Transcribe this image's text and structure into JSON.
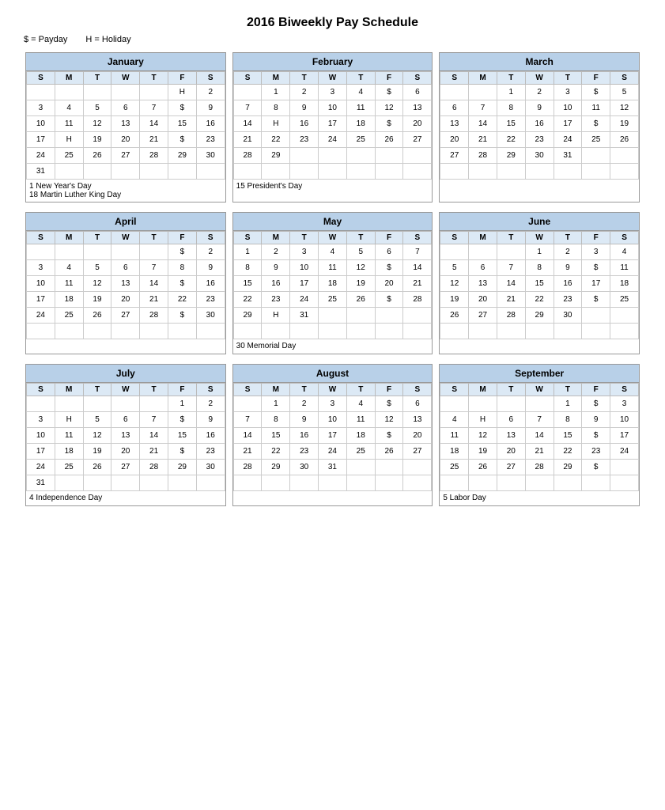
{
  "title": "2016 Biweekly Pay Schedule",
  "legend": {
    "payday": "$ = Payday",
    "holiday": "H = Holiday"
  },
  "months": [
    {
      "name": "January",
      "days_header": [
        "S",
        "M",
        "T",
        "W",
        "T",
        "F",
        "S"
      ],
      "rows": [
        [
          "",
          "",
          "",
          "",
          "",
          "H",
          "2"
        ],
        [
          "3",
          "4",
          "5",
          "6",
          "7",
          "$",
          "9"
        ],
        [
          "10",
          "11",
          "12",
          "13",
          "14",
          "15",
          "16"
        ],
        [
          "17",
          "H",
          "19",
          "20",
          "21",
          "$",
          "23"
        ],
        [
          "24",
          "25",
          "26",
          "27",
          "28",
          "29",
          "30"
        ],
        [
          "31",
          "",
          "",
          "",
          "",
          "",
          ""
        ]
      ],
      "footnotes": [
        "1 New Year's Day",
        "18 Martin Luther King Day"
      ]
    },
    {
      "name": "February",
      "days_header": [
        "S",
        "M",
        "T",
        "W",
        "T",
        "F",
        "S"
      ],
      "rows": [
        [
          "",
          "1",
          "2",
          "3",
          "4",
          "$",
          "6"
        ],
        [
          "7",
          "8",
          "9",
          "10",
          "11",
          "12",
          "13"
        ],
        [
          "14",
          "H",
          "16",
          "17",
          "18",
          "$",
          "20"
        ],
        [
          "21",
          "22",
          "23",
          "24",
          "25",
          "26",
          "27"
        ],
        [
          "28",
          "29",
          "",
          "",
          "",
          "",
          ""
        ],
        [
          "",
          "",
          "",
          "",
          "",
          "",
          ""
        ]
      ],
      "footnotes": [
        "15  President's Day"
      ]
    },
    {
      "name": "March",
      "days_header": [
        "S",
        "M",
        "T",
        "W",
        "T",
        "F",
        "S"
      ],
      "rows": [
        [
          "",
          "",
          "1",
          "2",
          "3",
          "$",
          "5"
        ],
        [
          "6",
          "7",
          "8",
          "9",
          "10",
          "11",
          "12"
        ],
        [
          "13",
          "14",
          "15",
          "16",
          "17",
          "$",
          "19"
        ],
        [
          "20",
          "21",
          "22",
          "23",
          "24",
          "25",
          "26"
        ],
        [
          "27",
          "28",
          "29",
          "30",
          "31",
          "",
          ""
        ],
        [
          "",
          "",
          "",
          "",
          "",
          "",
          ""
        ]
      ],
      "footnotes": []
    },
    {
      "name": "April",
      "days_header": [
        "S",
        "M",
        "T",
        "W",
        "T",
        "F",
        "S"
      ],
      "rows": [
        [
          "",
          "",
          "",
          "",
          "",
          "$",
          "2"
        ],
        [
          "3",
          "4",
          "5",
          "6",
          "7",
          "8",
          "9"
        ],
        [
          "10",
          "11",
          "12",
          "13",
          "14",
          "$",
          "16"
        ],
        [
          "17",
          "18",
          "19",
          "20",
          "21",
          "22",
          "23"
        ],
        [
          "24",
          "25",
          "26",
          "27",
          "28",
          "$",
          "30"
        ],
        [
          "",
          "",
          "",
          "",
          "",
          "",
          ""
        ]
      ],
      "footnotes": []
    },
    {
      "name": "May",
      "days_header": [
        "S",
        "M",
        "T",
        "W",
        "T",
        "F",
        "S"
      ],
      "rows": [
        [
          "1",
          "2",
          "3",
          "4",
          "5",
          "6",
          "7"
        ],
        [
          "8",
          "9",
          "10",
          "11",
          "12",
          "$",
          "14"
        ],
        [
          "15",
          "16",
          "17",
          "18",
          "19",
          "20",
          "21"
        ],
        [
          "22",
          "23",
          "24",
          "25",
          "26",
          "$",
          "28"
        ],
        [
          "29",
          "H",
          "31",
          "",
          "",
          "",
          ""
        ],
        [
          "",
          "",
          "",
          "",
          "",
          "",
          ""
        ]
      ],
      "footnotes": [
        "30  Memorial Day"
      ]
    },
    {
      "name": "June",
      "days_header": [
        "S",
        "M",
        "T",
        "W",
        "T",
        "F",
        "S"
      ],
      "rows": [
        [
          "",
          "",
          "",
          "1",
          "2",
          "3",
          "4"
        ],
        [
          "5",
          "6",
          "7",
          "8",
          "9",
          "$",
          "11"
        ],
        [
          "12",
          "13",
          "14",
          "15",
          "16",
          "17",
          "18"
        ],
        [
          "19",
          "20",
          "21",
          "22",
          "23",
          "$",
          "25"
        ],
        [
          "26",
          "27",
          "28",
          "29",
          "30",
          "",
          ""
        ],
        [
          "",
          "",
          "",
          "",
          "",
          "",
          ""
        ]
      ],
      "footnotes": []
    },
    {
      "name": "July",
      "days_header": [
        "S",
        "M",
        "T",
        "W",
        "T",
        "F",
        "S"
      ],
      "rows": [
        [
          "",
          "",
          "",
          "",
          "",
          "1",
          "2"
        ],
        [
          "3",
          "H",
          "5",
          "6",
          "7",
          "$",
          "9"
        ],
        [
          "10",
          "11",
          "12",
          "13",
          "14",
          "15",
          "16"
        ],
        [
          "17",
          "18",
          "19",
          "20",
          "21",
          "$",
          "23"
        ],
        [
          "24",
          "25",
          "26",
          "27",
          "28",
          "29",
          "30"
        ],
        [
          "31",
          "",
          "",
          "",
          "",
          "",
          ""
        ]
      ],
      "footnotes": [
        "4 Independence Day"
      ]
    },
    {
      "name": "August",
      "days_header": [
        "S",
        "M",
        "T",
        "W",
        "T",
        "F",
        "S"
      ],
      "rows": [
        [
          "",
          "1",
          "2",
          "3",
          "4",
          "$",
          "6"
        ],
        [
          "7",
          "8",
          "9",
          "10",
          "11",
          "12",
          "13"
        ],
        [
          "14",
          "15",
          "16",
          "17",
          "18",
          "$",
          "20"
        ],
        [
          "21",
          "22",
          "23",
          "24",
          "25",
          "26",
          "27"
        ],
        [
          "28",
          "29",
          "30",
          "31",
          "",
          "",
          ""
        ],
        [
          "",
          "",
          "",
          "",
          "",
          "",
          ""
        ]
      ],
      "footnotes": []
    },
    {
      "name": "September",
      "days_header": [
        "S",
        "M",
        "T",
        "W",
        "T",
        "F",
        "S"
      ],
      "rows": [
        [
          "",
          "",
          "",
          "",
          "1",
          "$",
          "3"
        ],
        [
          "4",
          "H",
          "6",
          "7",
          "8",
          "9",
          "10"
        ],
        [
          "11",
          "12",
          "13",
          "14",
          "15",
          "$",
          "17"
        ],
        [
          "18",
          "19",
          "20",
          "21",
          "22",
          "23",
          "24"
        ],
        [
          "25",
          "26",
          "27",
          "28",
          "29",
          "$",
          ""
        ],
        [
          "",
          "",
          "",
          "",
          "",
          "",
          ""
        ]
      ],
      "footnotes": [
        "5 Labor Day"
      ]
    }
  ]
}
